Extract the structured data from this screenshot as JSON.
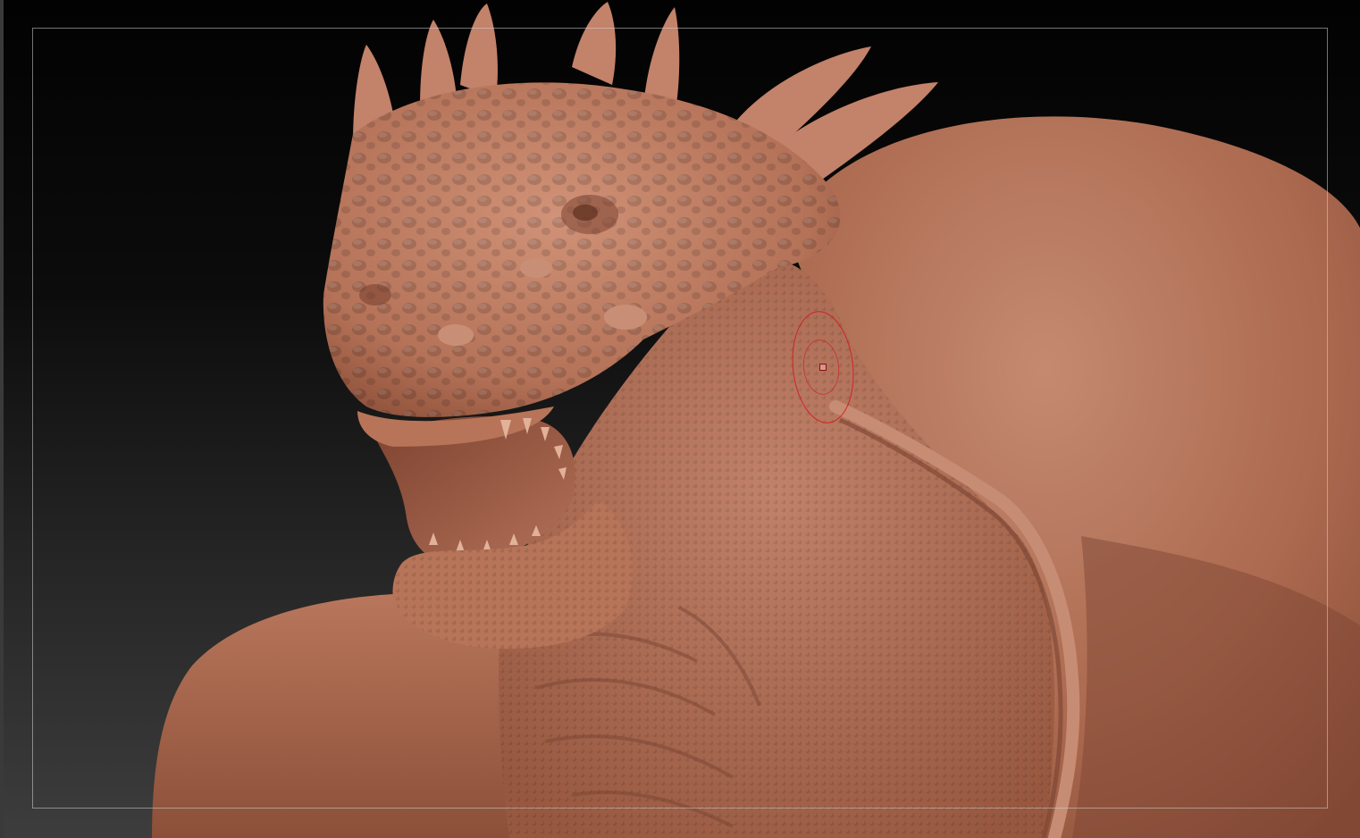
{
  "viewport": {
    "background_top": "#020202",
    "background_bottom": "#3d3d3d"
  },
  "model": {
    "material_color": "#b8745b",
    "highlight_color": "#d89a80",
    "shadow_color": "#6e3a28"
  },
  "brush_cursor": {
    "outer_color": "#d02222",
    "center_color": "#8a0d0d"
  },
  "icons": {
    "brush": "ellipse-brush-cursor-icon"
  }
}
